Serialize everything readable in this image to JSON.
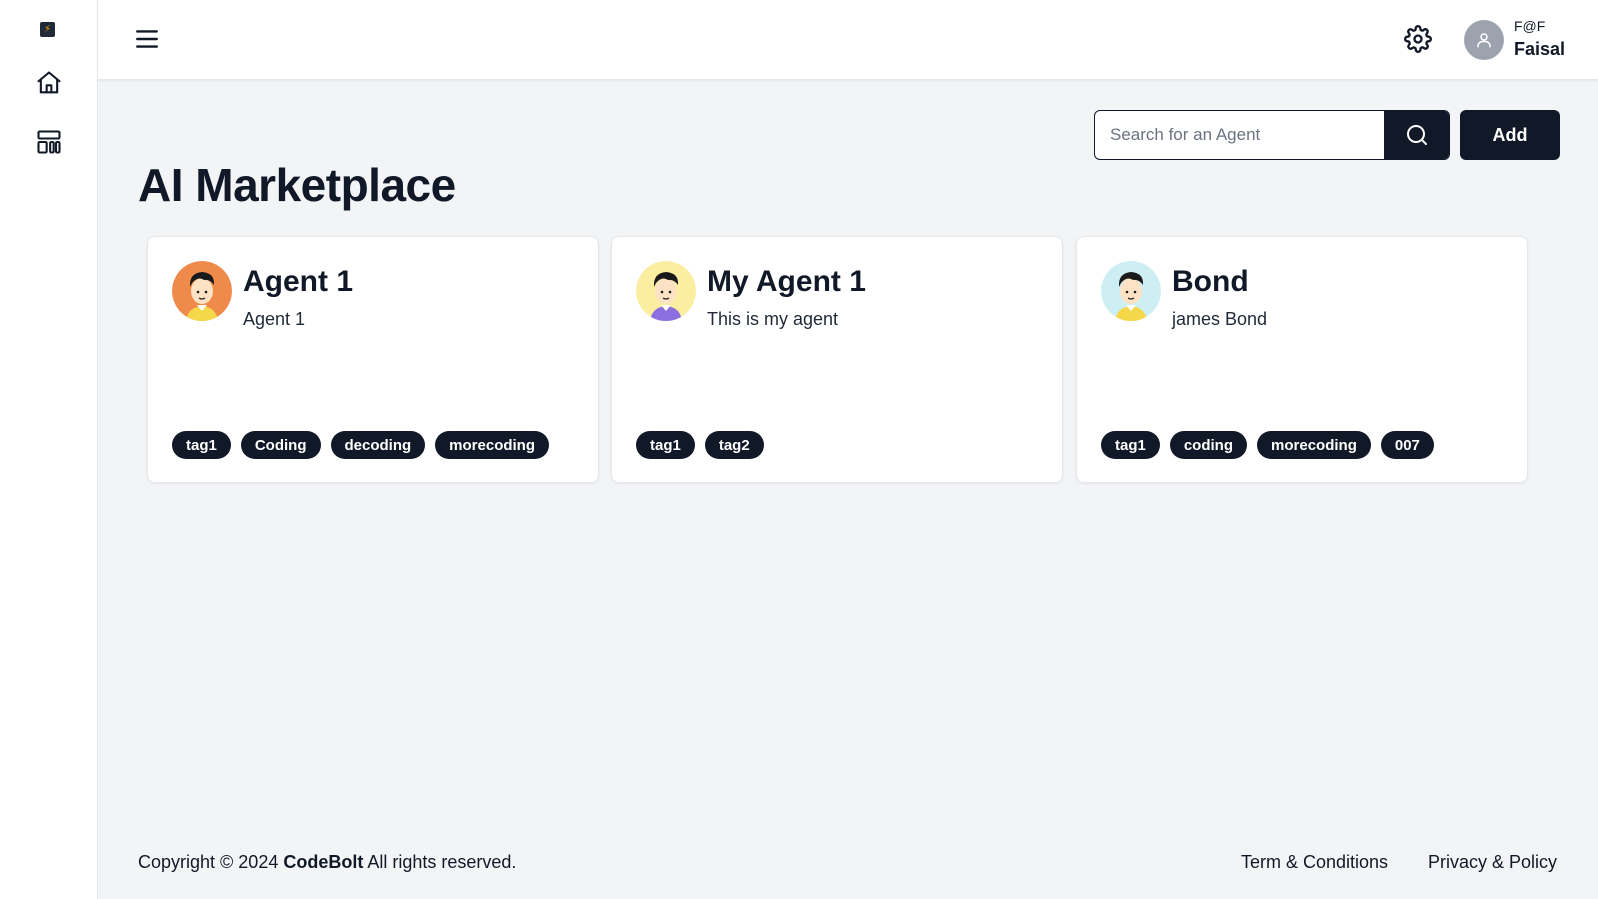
{
  "sidebar": {
    "logo_icon": "bolt-logo",
    "items": [
      {
        "icon": "home-icon"
      },
      {
        "icon": "layout-icon"
      }
    ]
  },
  "header": {
    "menu_icon": "hamburger-menu-icon",
    "settings_icon": "gear-icon",
    "user": {
      "handle": "F@F",
      "name": "Faisal"
    }
  },
  "main": {
    "title": "AI Marketplace",
    "search": {
      "placeholder": "Search for an Agent",
      "value": ""
    },
    "add_label": "Add",
    "agents": [
      {
        "name": "Agent 1",
        "description": "Agent 1",
        "avatar_bg": "#f08a4b",
        "shirt": "#f5d84a",
        "tags": [
          "tag1",
          "Coding",
          "decoding",
          "morecoding"
        ]
      },
      {
        "name": "My Agent 1",
        "description": "This is my agent",
        "avatar_bg": "#fbeea0",
        "shirt": "#8b6fe0",
        "tags": [
          "tag1",
          "tag2"
        ]
      },
      {
        "name": "Bond",
        "description": "james Bond",
        "avatar_bg": "#cdeef3",
        "shirt": "#f5d84a",
        "tags": [
          "tag1",
          "coding",
          "morecoding",
          "007"
        ]
      }
    ]
  },
  "footer": {
    "copyright_prefix": "Copyright © 2024",
    "brand": "CodeBolt",
    "copyright_suffix": "All rights reserved.",
    "terms": "Term & Conditions",
    "privacy": "Privacy & Policy"
  },
  "colors": {
    "primary": "#111827",
    "background": "#f3f4f6",
    "card": "#ffffff"
  }
}
